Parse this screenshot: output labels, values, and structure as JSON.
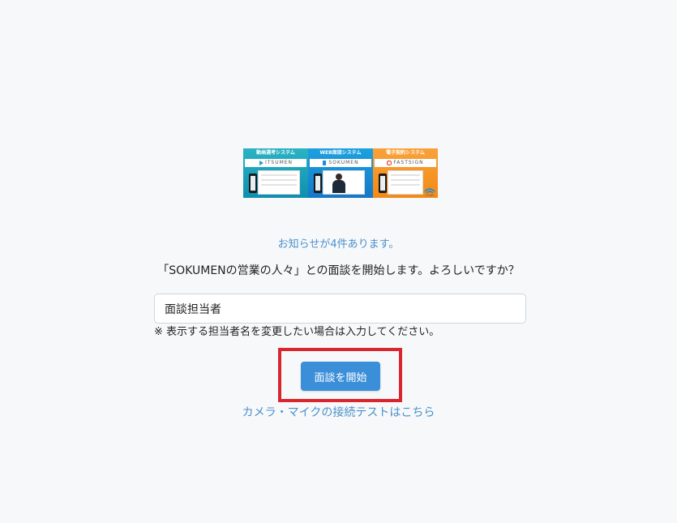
{
  "banner": {
    "panels": [
      {
        "caption": "動画選考システム",
        "logo": "ITSUMEN"
      },
      {
        "caption": "WEB面接システム",
        "logo": "SOKUMEN"
      },
      {
        "caption": "電子契約システム",
        "logo": "FASTSIGN"
      }
    ],
    "brand_mark": "merge",
    "colors": {
      "itsumen": "#1aa3bd",
      "sokumen": "#1a8ddb",
      "fastsign": "#f5961f"
    }
  },
  "notice_link": "お知らせが4件あります。",
  "confirm_question": "「SOKUMENの営業の人々」との面談を開始します。よろしいですか？",
  "interviewer_input": {
    "value": "面談担当者",
    "placeholder": ""
  },
  "hint_text": "※ 表示する担当者名を変更したい場合は入力してください。",
  "start_button_label": "面談を開始",
  "camera_test_link": "カメラ・マイクの接続テストはこちら",
  "colors": {
    "accent": "#3b8fd8",
    "link": "#4a90cc",
    "highlight": "#d9262e",
    "background": "#f7f8fa"
  }
}
